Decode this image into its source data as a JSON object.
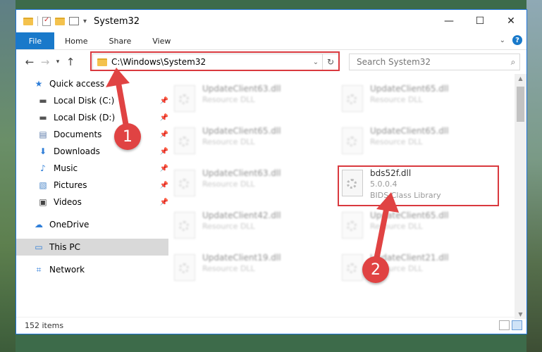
{
  "window": {
    "title": "System32",
    "controls": {
      "minimize": "—",
      "maximize": "☐",
      "close": "✕"
    }
  },
  "ribbon": {
    "tabs": [
      "File",
      "Home",
      "Share",
      "View"
    ],
    "help": "?"
  },
  "address": {
    "path": "C:\\Windows\\System32",
    "search_placeholder": "Search System32"
  },
  "sidebar": {
    "items": [
      {
        "label": "Quick access",
        "icon": "star-icon"
      },
      {
        "label": "Local Disk (C:)",
        "icon": "drive-icon"
      },
      {
        "label": "Local Disk (D:)",
        "icon": "drive-icon"
      },
      {
        "label": "Documents",
        "icon": "documents-icon"
      },
      {
        "label": "Downloads",
        "icon": "download-icon"
      },
      {
        "label": "Music",
        "icon": "music-icon"
      },
      {
        "label": "Pictures",
        "icon": "pictures-icon"
      },
      {
        "label": "Videos",
        "icon": "videos-icon"
      },
      {
        "label": "OneDrive",
        "icon": "cloud-icon"
      },
      {
        "label": "This PC",
        "icon": "computer-icon"
      },
      {
        "label": "Network",
        "icon": "network-icon"
      }
    ]
  },
  "files": [
    {
      "name": "UpdateClient63.dll",
      "desc": "Resource DLL"
    },
    {
      "name": "UpdateClient65.dll",
      "desc": "Resource DLL"
    },
    {
      "name": "UpdateClient65.dll",
      "desc": "Resource DLL"
    },
    {
      "name": "UpdateClient65.dll",
      "desc": "Resource DLL"
    },
    {
      "name": "UpdateClient63.dll",
      "desc": "Resource DLL"
    },
    {
      "name": "bds52f.dll",
      "desc": "5.0.0.4",
      "desc2": "BIDS Class Library"
    },
    {
      "name": "UpdateClient42.dll",
      "desc": "Resource DLL"
    },
    {
      "name": "UpdateClient65.dll",
      "desc": "Resource DLL"
    },
    {
      "name": "UpdateClient19.dll",
      "desc": "Resource DLL"
    },
    {
      "name": "UpdateClient21.dll",
      "desc": "Resource DLL"
    }
  ],
  "status": {
    "count": "152 items"
  },
  "callouts": {
    "one": "1",
    "two": "2"
  },
  "colors": {
    "accent": "#1979ca",
    "highlight": "#d9393e"
  }
}
